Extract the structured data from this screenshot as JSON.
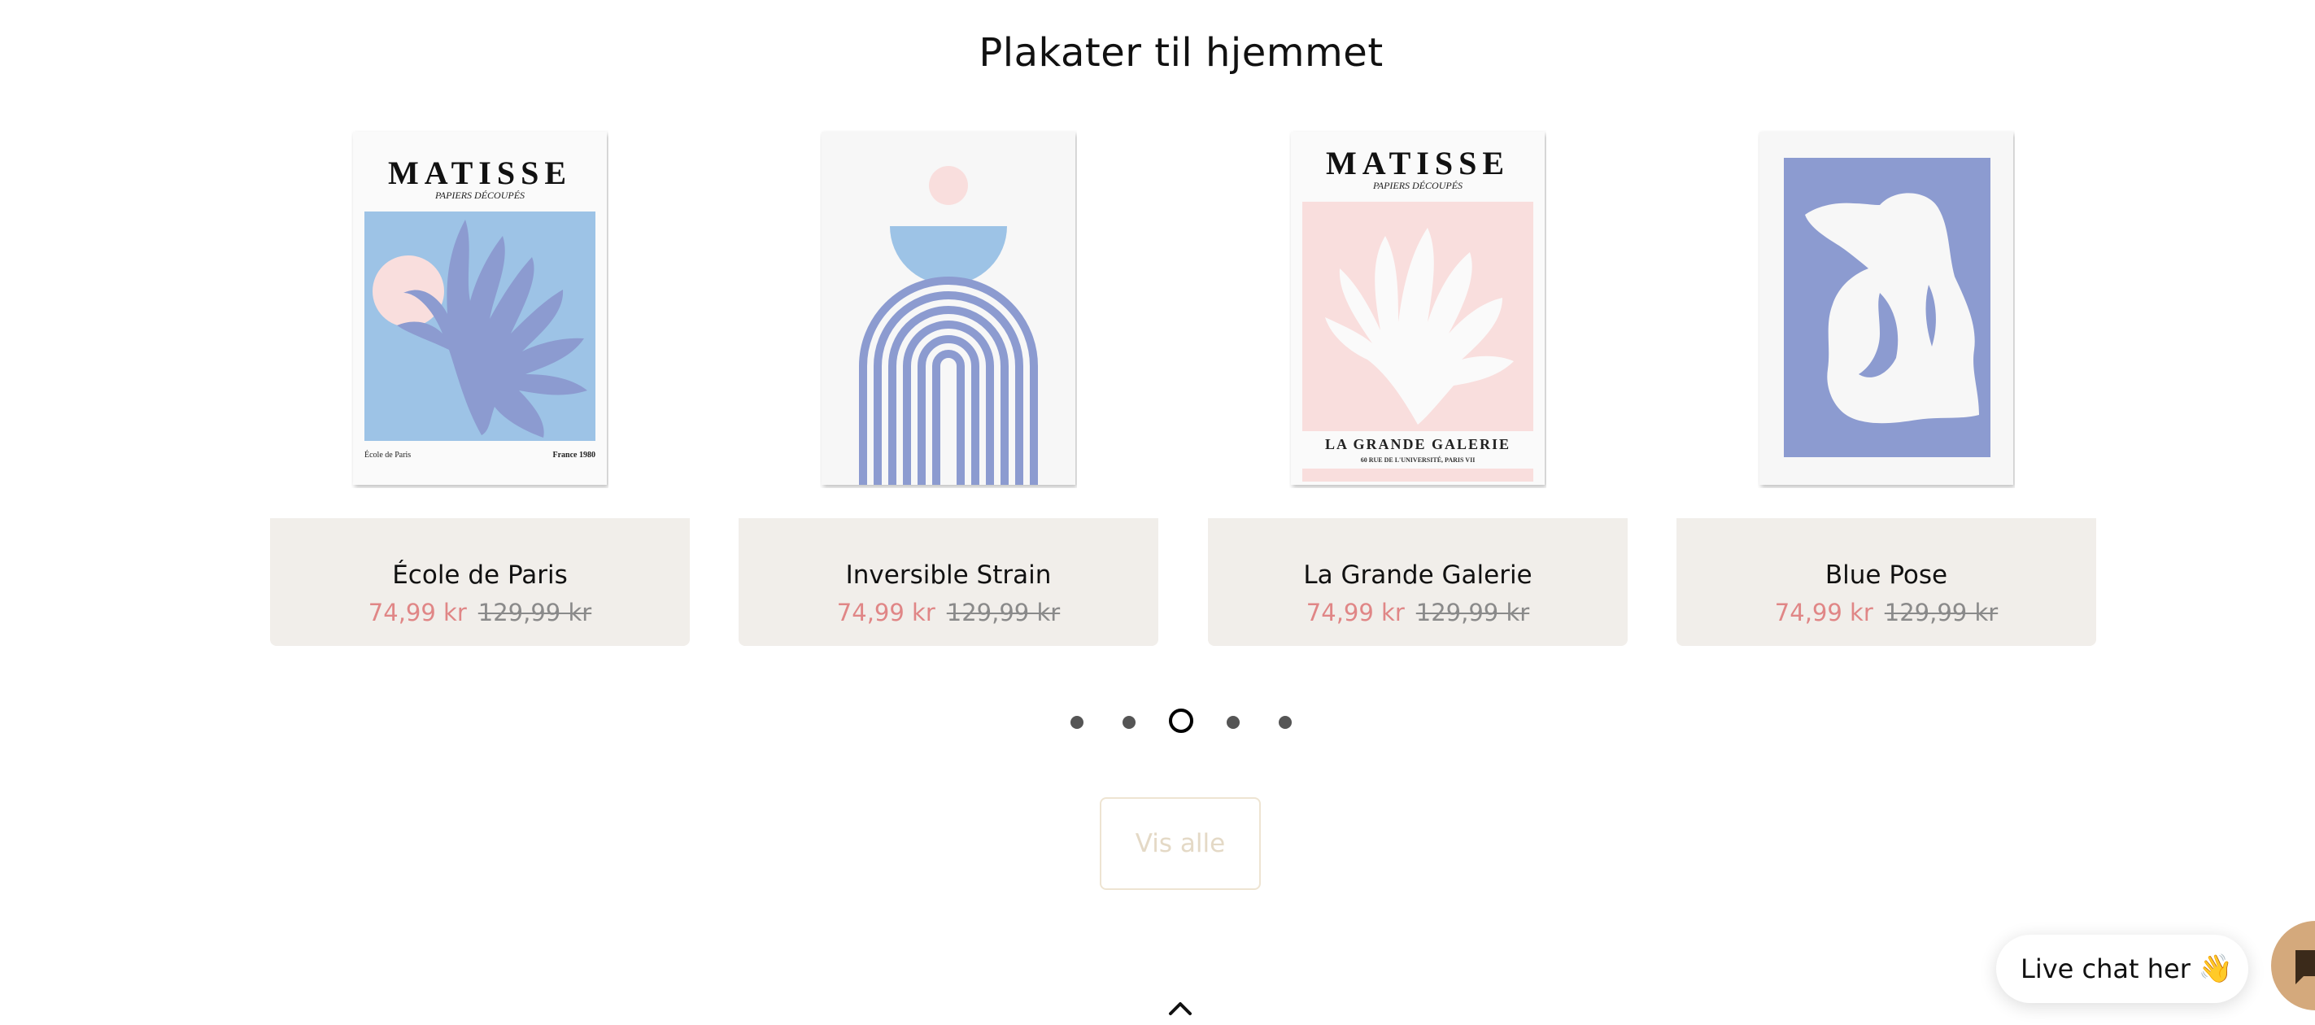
{
  "section": {
    "title": "Plakater til hjemmet"
  },
  "products": [
    {
      "name": "École de Paris",
      "sale_price": "74,99 kr",
      "old_price": "129,99 kr",
      "poster": {
        "heading": "MATISSE",
        "subheading": "PAPIERS DÉCOUPÉS",
        "footer_left": "École de Paris",
        "footer_right": "France 1980"
      }
    },
    {
      "name": "Inversible Strain",
      "sale_price": "74,99 kr",
      "old_price": "129,99 kr"
    },
    {
      "name": "La Grande Galerie",
      "sale_price": "74,99 kr",
      "old_price": "129,99 kr",
      "poster": {
        "heading": "MATISSE",
        "subheading": "PAPIERS DÉCOUPÉS",
        "footer_title": "LA GRANDE GALERIE",
        "footer_sub": "60 RUE DE L'UNIVERSITÉ, PARIS VII"
      }
    },
    {
      "name": "Blue Pose",
      "sale_price": "74,99 kr",
      "old_price": "129,99 kr"
    }
  ],
  "carousel": {
    "total_pages": 5,
    "active_page": 3
  },
  "view_all_label": "Vis alle",
  "scroll_top_icon": "chevron-up-icon",
  "chat": {
    "label": "Live chat her",
    "emoji": "👋",
    "launcher_icon": "chat-bubble-icon"
  },
  "colors": {
    "card_bg": "#f1eeea",
    "sale_price": "#e08686",
    "old_price": "#8a8a8a",
    "accent_beige": "#e4d9c6",
    "chat_launcher": "#d4a97c",
    "poster_blue": "#9dc3e6",
    "poster_purple": "#8c9bd0",
    "poster_pink": "#f9dedd"
  }
}
